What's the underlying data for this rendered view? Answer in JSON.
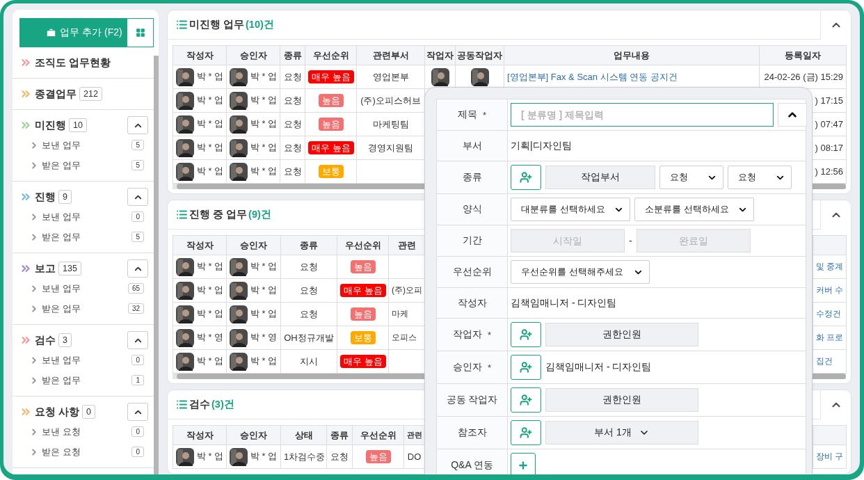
{
  "sidebar": {
    "add_button": "업무 추가 (F2)",
    "groups": [
      {
        "label": "조직도 업무현황",
        "color": "#f59a9a"
      },
      {
        "label": "종결업무",
        "count": "212",
        "color": "#f4b870"
      },
      {
        "label": "미진행",
        "count": "10",
        "color": "#9fd49a",
        "expanded": true,
        "children": [
          {
            "label": "보낸 업무",
            "count": "5"
          },
          {
            "label": "받은 업무",
            "count": "5"
          }
        ]
      },
      {
        "label": "진행",
        "count": "9",
        "color": "#7fb8e0",
        "expanded": true,
        "children": [
          {
            "label": "보낸 업무",
            "count": "0"
          },
          {
            "label": "받은 업무",
            "count": "5"
          }
        ]
      },
      {
        "label": "보고",
        "count": "135",
        "color": "#a98bd0",
        "expanded": true,
        "children": [
          {
            "label": "보낸 업무",
            "count": "65"
          },
          {
            "label": "받은 업무",
            "count": "32"
          }
        ]
      },
      {
        "label": "검수",
        "count": "3",
        "color": "#f59a9a",
        "expanded": true,
        "children": [
          {
            "label": "보낸 업무",
            "count": "0"
          },
          {
            "label": "받은 업무",
            "count": "1"
          }
        ]
      },
      {
        "label": "요청 사항",
        "count": "0",
        "color": "#f4b870",
        "expanded": true,
        "children": [
          {
            "label": "보낸 요청",
            "count": "0"
          },
          {
            "label": "받은 요청",
            "count": "0"
          }
        ]
      }
    ]
  },
  "panels": [
    {
      "title": "미진행 업무",
      "count": "(10)건",
      "expanded": true,
      "columns": [
        "작성자",
        "승인자",
        "종류",
        "우선순위",
        "관련부서",
        "작업자",
        "공동작업자",
        "업무내용",
        "등록일자"
      ],
      "rows": [
        {
          "cells": [
            {
              "kind": "person",
              "text": "박 * 업"
            },
            {
              "kind": "person",
              "text": "박 * 업"
            },
            {
              "kind": "text",
              "text": "요청"
            },
            {
              "kind": "badge",
              "text": "매우 높음",
              "color": "#ff0000"
            },
            {
              "kind": "text",
              "text": "영업본부"
            },
            {
              "kind": "avatar"
            },
            {
              "kind": "avatar"
            },
            {
              "kind": "link",
              "text": "[영업본부] Fax & Scan 시스템 연동 공지건"
            },
            {
              "kind": "text",
              "text": "24-02-26 (금) 15:29"
            }
          ]
        },
        {
          "cells": [
            {
              "kind": "person",
              "text": "박 * 업"
            },
            {
              "kind": "person",
              "text": "박 * 업"
            },
            {
              "kind": "text",
              "text": "요청"
            },
            {
              "kind": "badge",
              "text": "높음",
              "color": "#f27171"
            },
            {
              "kind": "text",
              "text": "(주)오피스허브"
            },
            {
              "kind": "empty"
            },
            {
              "kind": "empty"
            },
            {
              "kind": "empty"
            },
            {
              "kind": "text",
              "text": ") 17:15"
            }
          ]
        },
        {
          "cells": [
            {
              "kind": "person",
              "text": "박 * 업"
            },
            {
              "kind": "person",
              "text": "박 * 업"
            },
            {
              "kind": "text",
              "text": "요청"
            },
            {
              "kind": "badge",
              "text": "높음",
              "color": "#f27171"
            },
            {
              "kind": "text",
              "text": "마케팅팀"
            },
            {
              "kind": "empty"
            },
            {
              "kind": "empty"
            },
            {
              "kind": "empty"
            },
            {
              "kind": "text",
              "text": ") 07:47"
            }
          ]
        },
        {
          "cells": [
            {
              "kind": "person",
              "text": "박 * 업"
            },
            {
              "kind": "person",
              "text": "박 * 업"
            },
            {
              "kind": "text",
              "text": "요청"
            },
            {
              "kind": "badge",
              "text": "매우 높음",
              "color": "#ff0000"
            },
            {
              "kind": "text",
              "text": "경영지원팀"
            },
            {
              "kind": "empty"
            },
            {
              "kind": "empty"
            },
            {
              "kind": "empty"
            },
            {
              "kind": "text",
              "text": ") 08:17"
            }
          ]
        },
        {
          "cells": [
            {
              "kind": "person",
              "text": "박 * 업"
            },
            {
              "kind": "person",
              "text": "박 * 업"
            },
            {
              "kind": "text",
              "text": "요청"
            },
            {
              "kind": "badge",
              "text": "보통",
              "color": "#ffaa00"
            },
            {
              "kind": "empty"
            },
            {
              "kind": "empty"
            },
            {
              "kind": "empty"
            },
            {
              "kind": "empty"
            },
            {
              "kind": "text",
              "text": ") 12:56"
            }
          ]
        }
      ]
    },
    {
      "title": "진행 중 업무",
      "count": "(9)건",
      "expanded": true,
      "columns": [
        "작성자",
        "승인자",
        "종류",
        "우선순위",
        "관련"
      ],
      "rows": [
        {
          "cells": [
            {
              "kind": "person",
              "text": "박 * 업"
            },
            {
              "kind": "person",
              "text": "박 * 업"
            },
            {
              "kind": "text",
              "text": "요청"
            },
            {
              "kind": "badge",
              "text": "높음",
              "color": "#f27171"
            },
            {
              "kind": "empty"
            },
            {
              "kind": "empty"
            },
            {
              "kind": "link",
              "text": "및 중계"
            }
          ]
        },
        {
          "cells": [
            {
              "kind": "person",
              "text": "박 * 업"
            },
            {
              "kind": "person",
              "text": "박 * 업"
            },
            {
              "kind": "text",
              "text": "요청"
            },
            {
              "kind": "badge",
              "text": "매우 높음",
              "color": "#ff0000"
            },
            {
              "kind": "text",
              "text": "(주)오피"
            },
            {
              "kind": "empty"
            },
            {
              "kind": "link",
              "text": "커버 수"
            }
          ]
        },
        {
          "cells": [
            {
              "kind": "person",
              "text": "박 * 업"
            },
            {
              "kind": "person",
              "text": "박 * 업"
            },
            {
              "kind": "text",
              "text": "요청"
            },
            {
              "kind": "badge",
              "text": "높음",
              "color": "#f27171"
            },
            {
              "kind": "text",
              "text": "마케"
            },
            {
              "kind": "empty"
            },
            {
              "kind": "link",
              "text": "수정건"
            }
          ]
        },
        {
          "cells": [
            {
              "kind": "person",
              "text": "박 * 영"
            },
            {
              "kind": "person",
              "text": "박 * 영"
            },
            {
              "kind": "text",
              "text": "OH정규개발"
            },
            {
              "kind": "badge",
              "text": "보통",
              "color": "#ffaa00"
            },
            {
              "kind": "text",
              "text": "오피스"
            },
            {
              "kind": "empty"
            },
            {
              "kind": "link",
              "text": "화 프로"
            }
          ]
        },
        {
          "cells": [
            {
              "kind": "person",
              "text": "박 * 업"
            },
            {
              "kind": "person",
              "text": "박 * 업"
            },
            {
              "kind": "text",
              "text": "지시"
            },
            {
              "kind": "badge",
              "text": "매우 높음",
              "color": "#ff0000"
            },
            {
              "kind": "empty"
            },
            {
              "kind": "empty"
            },
            {
              "kind": "link",
              "text": "집건"
            }
          ]
        }
      ]
    },
    {
      "title": "검수",
      "count": "(3)건",
      "expanded": true,
      "columns": [
        "작성자",
        "승인자",
        "상태",
        "종류",
        "우선순위",
        "관련"
      ],
      "rows": [
        {
          "cells": [
            {
              "kind": "person",
              "text": "박 * 업"
            },
            {
              "kind": "person",
              "text": "박 * 업"
            },
            {
              "kind": "text",
              "text": "1차검수중"
            },
            {
              "kind": "text",
              "text": "요청"
            },
            {
              "kind": "badge",
              "text": "높음",
              "color": "#f27171"
            },
            {
              "kind": "text",
              "text": "DO"
            },
            {
              "kind": "empty"
            },
            {
              "kind": "link",
              "text": "장비 구"
            }
          ]
        }
      ]
    }
  ],
  "form": {
    "rows": [
      {
        "label": "제목",
        "required_mark": "*",
        "controls": [
          {
            "kind": "input",
            "placeholder": "[ 분류명 ] 제목입력"
          },
          {
            "kind": "collapse"
          }
        ]
      },
      {
        "label": "부서",
        "controls": [
          {
            "kind": "text",
            "text": "기획|디자인팀"
          }
        ]
      },
      {
        "label": "종류",
        "controls": [
          {
            "kind": "add-user"
          },
          {
            "kind": "box",
            "text": "작업부서"
          },
          {
            "kind": "select",
            "value": "요청"
          },
          {
            "kind": "select",
            "value": "요청"
          }
        ]
      },
      {
        "label": "양식",
        "controls": [
          {
            "kind": "select",
            "value": "대분류를 선택하세요"
          },
          {
            "kind": "select",
            "value": "소분류를 선택하세요"
          }
        ]
      },
      {
        "label": "기간",
        "controls": [
          {
            "kind": "date",
            "placeholder": "시작일"
          },
          {
            "kind": "dash",
            "text": "-"
          },
          {
            "kind": "date",
            "placeholder": "완료일"
          }
        ]
      },
      {
        "label": "우선순위",
        "controls": [
          {
            "kind": "select",
            "value": "우선순위를 선택해주세요"
          }
        ]
      },
      {
        "label": "작성자",
        "controls": [
          {
            "kind": "text",
            "text": "김책임매니저 - 디자인팀"
          }
        ]
      },
      {
        "label": "작업자",
        "required_mark": "*",
        "controls": [
          {
            "kind": "add-user"
          },
          {
            "kind": "box",
            "text": "권한인원"
          }
        ]
      },
      {
        "label": "승인자",
        "required_mark": "*",
        "controls": [
          {
            "kind": "add-user"
          },
          {
            "kind": "text",
            "text": "김책임매니저 - 디자인팀"
          }
        ]
      },
      {
        "label": "공동 작업자",
        "controls": [
          {
            "kind": "add-user"
          },
          {
            "kind": "box",
            "text": "권한인원"
          }
        ]
      },
      {
        "label": "참조자",
        "controls": [
          {
            "kind": "add-user"
          },
          {
            "kind": "dropdown-box",
            "text": "부서 1개"
          }
        ]
      },
      {
        "label": "Q&A 연동",
        "controls": [
          {
            "kind": "plus"
          }
        ]
      }
    ]
  }
}
